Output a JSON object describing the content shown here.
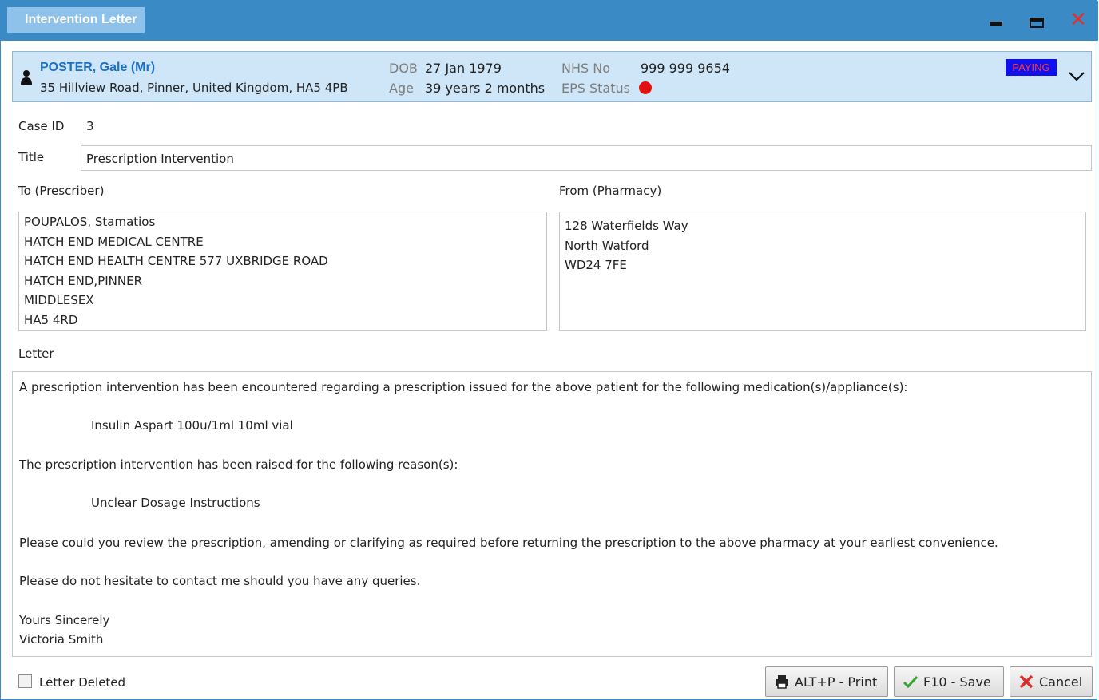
{
  "window": {
    "title": "Intervention Letter",
    "minimize_icon": "minimize-icon",
    "maximize_icon": "maximize-icon",
    "close_icon": "close-icon"
  },
  "patient": {
    "name": "POSTER, Gale (Mr)",
    "address": "35 Hillview Road, Pinner, United Kingdom, HA5 4PB",
    "dob_label": "DOB",
    "dob_value": "27 Jan 1979",
    "age_label": "Age",
    "age_value": "39 years 2 months",
    "nhs_label": "NHS No",
    "nhs_value": "999 999 9654",
    "eps_label": "EPS Status",
    "eps_status_color": "#e11111",
    "badge": "PAYING",
    "badge_bg": "#1010ee",
    "badge_fg": "#ff3a3a"
  },
  "form": {
    "case_id_label": "Case ID",
    "case_id_value": "3",
    "title_label": "Title",
    "title_value": "Prescription Intervention",
    "to_label": "To (Prescriber)",
    "to_lines": [
      "POUPALOS, Stamatios",
      "HATCH END MEDICAL CENTRE",
      "HATCH END HEALTH CENTRE 577 UXBRIDGE ROAD",
      "HATCH END,PINNER",
      "MIDDLESEX",
      "HA5 4RD"
    ],
    "from_label": "From (Pharmacy)",
    "from_lines": [
      "128 Waterfields Way",
      "North Watford",
      "WD24 7FE"
    ],
    "letter_label": "Letter",
    "letter": {
      "intro": "A prescription intervention has been encountered regarding a prescription issued for the above patient for the following medication(s)/appliance(s):",
      "medication": "Insulin Aspart 100u/1ml 10ml vial",
      "reason_intro": "The prescription intervention has been raised for the following reason(s):",
      "reason": "Unclear Dosage Instructions",
      "request": "Please could you review the prescription, amending or clarifying as required before returning the prescription to the above pharmacy at your earliest convenience.",
      "contact": "Please do not hesitate to contact me should you have any queries.",
      "closing": "Yours Sincerely",
      "signature": "Victoria Smith"
    }
  },
  "footer": {
    "deleted_label": "Letter Deleted",
    "deleted_checked": false,
    "print_label": "ALT+P - Print",
    "save_label": "F10 - Save",
    "cancel_label": "Cancel"
  }
}
